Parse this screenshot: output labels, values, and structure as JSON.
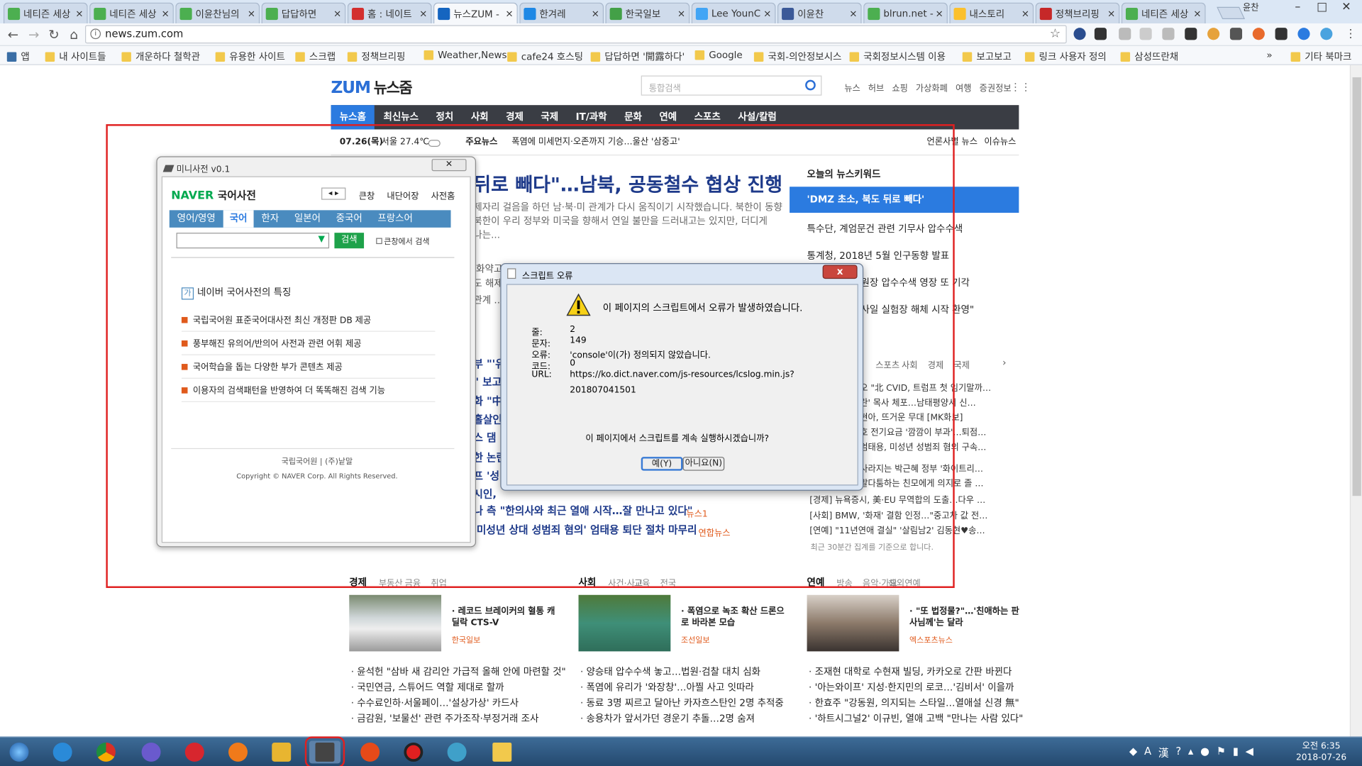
{
  "tabs": [
    {
      "label": "네티즌 세상",
      "fav": "#4caf50"
    },
    {
      "label": "네티즌 세상",
      "fav": "#4caf50"
    },
    {
      "label": "이윤찬님의",
      "fav": "#4caf50"
    },
    {
      "label": "답답하면",
      "fav": "#4caf50"
    },
    {
      "label": "홈 : 네이트",
      "fav": "#d32f2f"
    },
    {
      "label": "뉴스ZUM -",
      "fav": "#1565c0"
    },
    {
      "label": "한겨레",
      "fav": "#1e88e5"
    },
    {
      "label": "한국일보",
      "fav": "#43a047"
    },
    {
      "label": "Lee YounC",
      "fav": "#42a5f5"
    },
    {
      "label": "이윤찬",
      "fav": "#3b5998"
    },
    {
      "label": "blrun.net -",
      "fav": "#4caf50"
    },
    {
      "label": "내스토리",
      "fav": "#fbc02d"
    },
    {
      "label": "정책브리핑",
      "fav": "#c62828"
    },
    {
      "label": "네티즌 세상",
      "fav": "#4caf50"
    }
  ],
  "tab_close": "×",
  "profile": "윤찬",
  "address": "news.zum.com",
  "bookmarks": [
    "앱",
    "내 사이트들",
    "개운하다 철학관",
    "유용한 사이트",
    "스크랩",
    "정책브리핑",
    "Weather,News",
    "cafe24 호스팅",
    "답답하면 '開露하다'",
    "Google",
    "국회-의안정보시스",
    "국회정보시스템 이용",
    "보고보고",
    "링크 사용자 정의",
    "삼성뜨란채"
  ],
  "bookmarks_more": "»",
  "bookmarks_other": "기타 북마크",
  "zum": {
    "logo": "ZUM",
    "logo_sub": "뉴스줌",
    "search_placeholder": "통합검색",
    "toplinks": [
      "뉴스",
      "허브",
      "쇼핑",
      "가상화폐",
      "여행",
      "증권정보"
    ]
  },
  "gnb": [
    "뉴스홈",
    "최신뉴스",
    "정치",
    "사회",
    "경제",
    "국제",
    "IT/과학",
    "문화",
    "연예",
    "스포츠",
    "사설/칼럼"
  ],
  "subbar": {
    "date": "07.26(목)",
    "weather": "서울 27.4℃",
    "label": "주요뉴스",
    "ticker": "폭염에 미세먼지·오존까지 기승…울산 '삼중고'",
    "right1": "언론사별 뉴스",
    "right2": "이슈뉴스"
  },
  "headline": "뒤로 빼다\"…남북, 공동철수 협상 진행",
  "lead1": "제자리 걸음을 하던 남·북·미 관계가 다시 움직이기 시작했습니다. 북한이 동향",
  "lead2": "북한이 우리 정부와 미국을 향해서 연일 불만을 드러내고는 있지만, 더디게",
  "lead3": "나는...",
  "headlist": [
    "'화약고' 고 미소 ...",
    "도 해제",
    "관계 ...",
    "부 \"'유",
    "\" 보고",
    "화 \"中",
    "홀살인",
    "스 댐 '",
    "한 논란",
    "프 '성",
    "시인,",
    "나 측 \"한의사와 최근 열애 시작…잘 만나고 있다\"",
    "'미성년 상대 성범죄 혐의' 엄태용 퇴단 절차 마무리"
  ],
  "headlist_src": [
    "뉴스1",
    "연합뉴스"
  ],
  "keywords": {
    "title": "오늘의 뉴스키워드",
    "items": [
      "'DMZ 초소, 북도 뒤로 빼다'",
      "특수단, 계엄문건 관련 기무사 압수수색",
      "통계청, 2018년 5월 인구동향 발표",
      "원장 압수수색 영장 또 기각",
      "사일 실험장 해체 시작 환영\""
    ]
  },
  "cat_tabs": [
    "스포츠",
    "사회",
    "경제",
    "국제"
  ],
  "right_list": [
    "오 \"北 CVID, 트럼프 첫 임기말까…",
    "란' 목사 체포…남태평양서 신…",
    "현아, 뜨거운 무대 [MK화보]",
    "호 전기요금 '깜깜이 부과'…퇴점…",
    "엄태용, 미성년 성범죄 혐의 구속…",
    "사라지는 박근혜 정부 '화이트리…",
    "말다툼하는 친모에게 의지로 졸 …",
    "[경제] 뉴욕증시, 美·EU 무역합의 도출…다우 …",
    "[사회] BMW, '화재' 결함 인정…\"중고차 값 전…",
    "[연예] \"11년연애 결실\" '살림남2' 김동현♥송…"
  ],
  "right_note": "최근 30분간 집계를 기준으로 합니다.",
  "sections": [
    {
      "title": "경제",
      "subs": [
        "부동산",
        "금융",
        "취업"
      ],
      "card": "레코드 브레이커의 혈통 캐딜락 CTS-V",
      "src": "한국일보",
      "list": [
        "윤석헌 \"삼바 새 감리안 가급적 올해 안에 마련할 것\"",
        "국민연금, 스튜어드 역할 제대로 할까",
        "수수료인하·서울페이…'설상가상' 카드사",
        "금감원, '보물선' 관련 주가조작·부정거래 조사"
      ]
    },
    {
      "title": "사회",
      "subs": [
        "사건·사고",
        "교육",
        "전국"
      ],
      "card": "폭염으로 녹조 확산 드론으로 바라본 모습",
      "src": "조선일보",
      "list": [
        "양승태 압수수색 놓고…법원·검찰 대치 심화",
        "폭염에 유리가 '와장창'…아찔 사고 잇따라",
        "동료 3명 찌르고 달아난 카자흐스탄인 2명 추적중",
        "송용차가 앞서가던 경운기 추돌…2명 숨져"
      ]
    },
    {
      "title": "연예",
      "subs": [
        "방송",
        "음악·가요",
        "해외연예"
      ],
      "card": "\"또 법정물?\"…'친애하는 판사님께'는 달라",
      "src": "엑스포츠뉴스",
      "list": [
        "조재현 대학로 수현재 빌딩, 카카오로 간판 바뀐다",
        "'아는와이프' 지성·한지민의 로코…'김비서' 이을까",
        "한효주 \"강동원, 의지되는 스타일…열애설 신경 無\"",
        "'하트시그널2' 이규빈, 열애 고백 \"만나는 사람 있다\""
      ]
    }
  ],
  "mini": {
    "caption": "미니사전 v0.1",
    "close": "✕",
    "brand": "NAVER",
    "brand_sub": "국어사전",
    "opts": [
      "큰창",
      "내단어장",
      "사전홈"
    ],
    "tabs": [
      "영어/영영",
      "국어",
      "한자",
      "일본어",
      "중국어",
      "프랑스어"
    ],
    "search_btn": "검색",
    "bigwin": "큰창에서 검색",
    "feat_title": "네이버 국어사전의 특징",
    "feat_badge": "가",
    "features": [
      "국립국어원 표준국어대사전 최신 개정판 DB 제공",
      "풍부해진 유의어/반의어 사전과 관련 어휘 제공",
      "국어학습을 돕는 다양한 부가 콘텐츠 제공",
      "이용자의 검색패턴을 반영하여 더 똑똑해진 검색 기능"
    ],
    "footer1": "국립국어원 | (주)낱말",
    "footer2": "Copyright © NAVER Corp. All Rights Reserved."
  },
  "dialog": {
    "title": "스크립트 오류",
    "close": "x",
    "msg": "이 페이지의 스크립트에서 오류가 발생하였습니다.",
    "labels": [
      "줄:",
      "문자:",
      "오류:",
      "코드:",
      "URL:"
    ],
    "values": [
      "2",
      "149",
      "'console'이(가) 정의되지 않았습니다.",
      "0",
      "https://ko.dict.naver.com/js-resources/lcslog.min.js?"
    ],
    "url2": "201807041501",
    "question": "이 페이지에서 스크립트를 계속 실행하시겠습니까?",
    "yes": "예(Y)",
    "no": "아니요(N)"
  },
  "taskbar": {
    "time": "오전 6:35",
    "date": "2018-07-26"
  }
}
